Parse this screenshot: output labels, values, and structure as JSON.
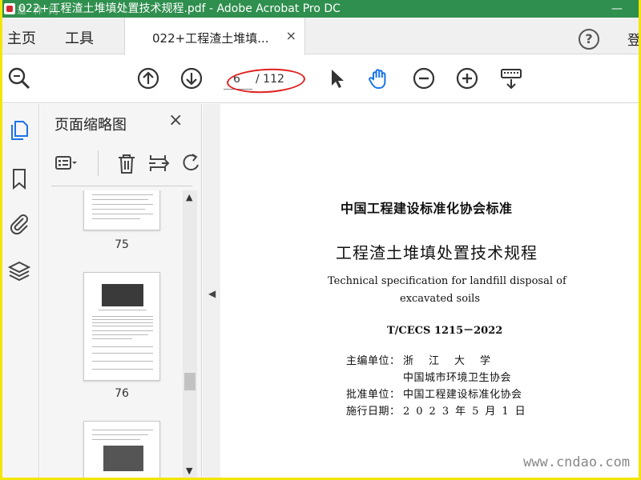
{
  "window": {
    "title": "022+工程渣土堆填处置技术规程.pdf - Adobe Acrobat Pro DC",
    "overlay_watermark": "道 林 网",
    "controls": "—"
  },
  "tabs": {
    "home": "主页",
    "tools": "工具",
    "document_tab": "022+工程渣土堆填...",
    "close": "×",
    "help": "?",
    "login": "登"
  },
  "toolbar": {
    "page_current": "6",
    "page_total": "/ 112",
    "icons": [
      "search-zoom-icon",
      "page-up-icon",
      "page-down-icon",
      "select-arrow-icon",
      "hand-icon",
      "zoom-out-icon",
      "zoom-in-icon",
      "keyboard-scroll-icon"
    ],
    "highlight_color": "#e02020",
    "accent": "#1a73e8"
  },
  "rail": {
    "icons": [
      "pages-icon",
      "bookmark-icon",
      "attachment-icon",
      "layers-icon"
    ]
  },
  "thumbnails": {
    "title": "页面缩略图",
    "close": "×",
    "tools": [
      "thumbnail-options-icon",
      "delete-icon",
      "insert-page-icon",
      "rotate-icon"
    ],
    "pages": [
      "75",
      "76"
    ]
  },
  "document": {
    "org_standard": "中国工程建设标准化协会标准",
    "title_cn": "工程渣土堆填处置技术规程",
    "title_en_1": "Technical specification for landfill disposal of",
    "title_en_2": "excavated soils",
    "code": "T/CECS 1215－2022",
    "chief_editor_label": "主编单位：",
    "chief_editor_1": "浙江大学",
    "chief_editor_2": "中国城市环境卫生协会",
    "approver_label": "批准单位：",
    "approver": "中国工程建设标准化协会",
    "date_label": "施行日期：",
    "date": "2023年5月1日"
  },
  "site_watermark": "www.cndao.com"
}
